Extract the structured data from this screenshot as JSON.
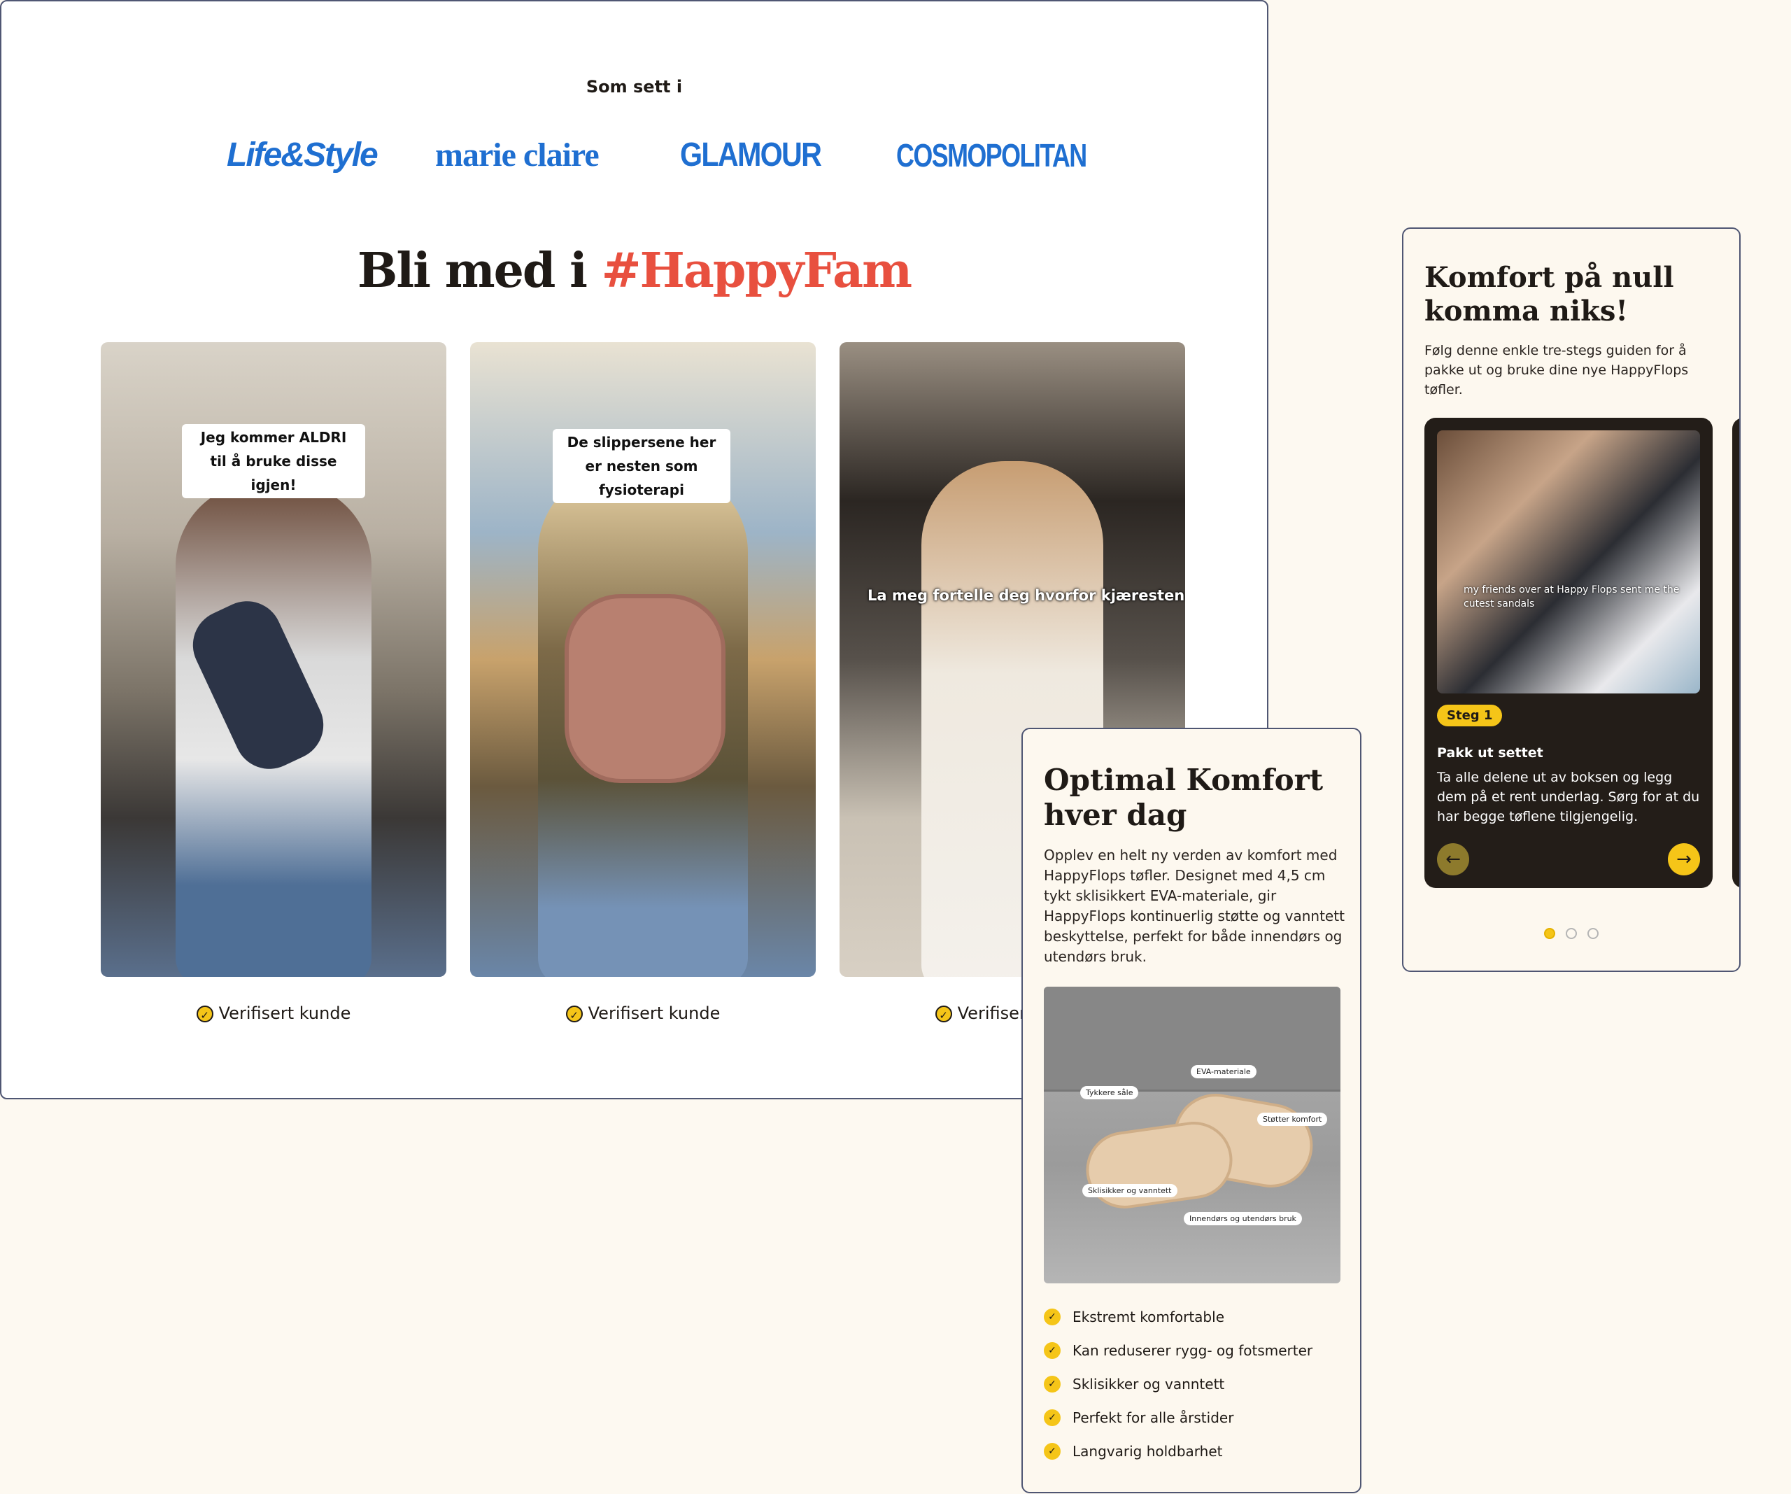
{
  "press": {
    "label": "Som sett i",
    "logos": [
      "Life&Style",
      "marie claire",
      "GLAMOUR",
      "COSMOPOLITAN"
    ]
  },
  "community": {
    "headline_prefix": "Bli med i ",
    "headline_hashtag": "#HappyFam",
    "videos": [
      {
        "caption": "Jeg kommer ALDRI til å bruke disse igjen!",
        "verified": "Verifisert kunde"
      },
      {
        "caption": "De slippersene her er nesten som fysioterapi",
        "verified": "Verifisert kunde"
      },
      {
        "caption": "La meg fortelle deg hvorfor kjæresten",
        "verified": "Verifisert kunde"
      }
    ]
  },
  "comfort": {
    "title": "Optimal Komfort hver dag",
    "description": "Opplev en helt ny verden av komfort med HappyFlops tøfler. Designet med 4,5 cm tykt sklisikkert EVA-materiale, gir HappyFlops kontinuerlig støtte og vanntett beskyttelse, perfekt for både innendørs og utendørs bruk.",
    "image_tags": [
      "Tykkere såle",
      "EVA-materiale",
      "Støtter komfort",
      "Sklisikker og vanntett",
      "Innendørs og utendørs bruk"
    ],
    "features": [
      "Ekstremt komfortable",
      "Kan reduserer rygg- og fotsmerter",
      "Sklisikker og vanntett",
      "Perfekt for alle årstider",
      "Langvarig holdbarhet"
    ]
  },
  "guide": {
    "title": "Komfort på null komma niks!",
    "description": "Følg denne enkle tre-stegs guiden for å pakke ut og bruke dine nye HappyFlops tøfler.",
    "step": {
      "photo_overlay": "my friends over at Happy Flops sent me the cutest sandals",
      "badge": "Steg 1",
      "title": "Pakk ut settet",
      "text": "Ta alle delene ut av boksen og legg dem på et rent underlag. Sørg for at du har begge tøflene tilgjengelig."
    },
    "nav_prev_icon": "arrow-left-icon",
    "nav_next_icon": "arrow-right-icon",
    "active_dot": 1,
    "dot_count": 3
  },
  "colors": {
    "accent_red": "#e8503f",
    "brand_yellow": "#f5c518",
    "logo_blue": "#1f6fd1",
    "dark_card": "#231d18",
    "cream": "#fdf8ef"
  }
}
